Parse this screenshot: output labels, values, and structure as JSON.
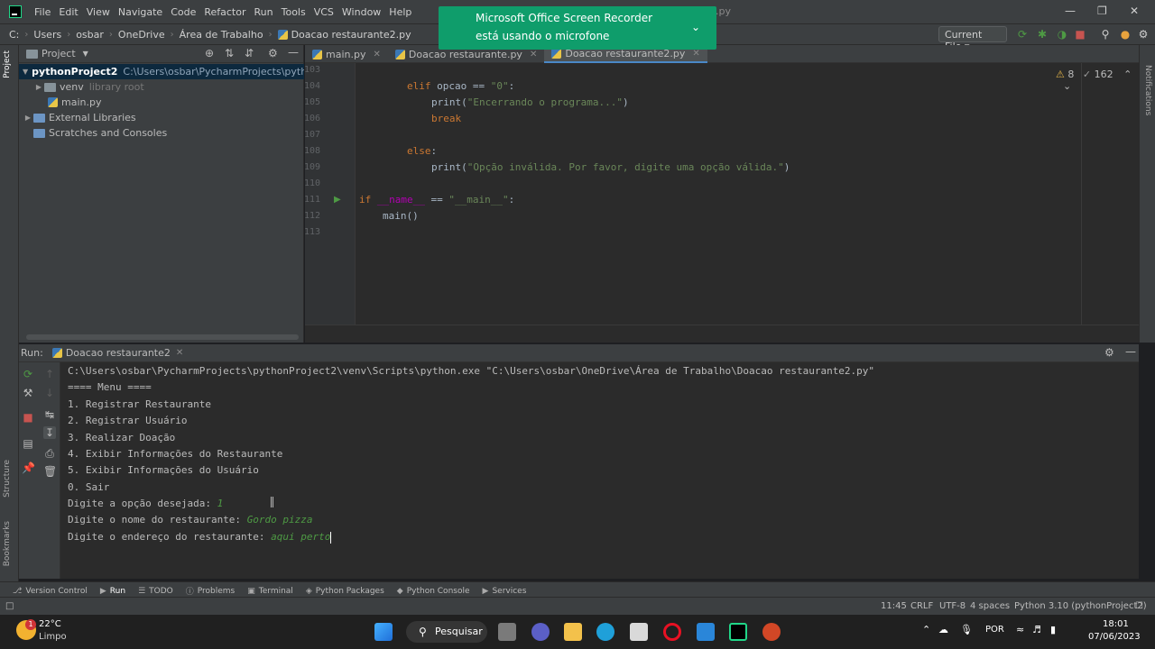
{
  "menu": [
    "File",
    "Edit",
    "View",
    "Navigate",
    "Code",
    "Refactor",
    "Run",
    "Tools",
    "VCS",
    "Window",
    "Help"
  ],
  "window_title_left": "pythonProj",
  "window_title_right": "2.py",
  "breadcrumb": [
    "C:",
    "Users",
    "osbar",
    "OneDrive",
    "Área de Trabalho",
    "Doacao restaurante2.py"
  ],
  "run_config": "Current File",
  "project": {
    "header": "Project",
    "tree": [
      {
        "label": "pythonProject2",
        "hint": "C:\\Users\\osbar\\PycharmProjects\\pythonProject2"
      },
      {
        "label": "venv",
        "hint": "library root"
      },
      {
        "label": "main.py",
        "hint": ""
      },
      {
        "label": "External Libraries",
        "hint": ""
      },
      {
        "label": "Scratches and Consoles",
        "hint": ""
      }
    ]
  },
  "editor_tabs": [
    "main.py",
    "Doacao restaurante.py",
    "Doacao restaurante2.py"
  ],
  "inspection": {
    "warnings": "8",
    "weak": "162"
  },
  "code": {
    "line_numbers": [
      "103",
      "104",
      "105",
      "106",
      "107",
      "108",
      "109",
      "110",
      "111",
      "112",
      "113"
    ],
    "l104_kw": "elif",
    "l104_rest": " opcao == ",
    "l104_str": "\"0\"",
    "l104_end": ":",
    "l105_fn": "print(",
    "l105_str": "\"Encerrando o programa...\"",
    "l105_end": ")",
    "l106_kw": "break",
    "l108_kw": "else",
    "l108_end": ":",
    "l109_fn": "print(",
    "l109_str": "\"Opção inválida. Por favor, digite uma opção válida.\"",
    "l109_end": ")",
    "l111_kw": "if",
    "l111_d1": "__name__",
    "l111_mid": " == ",
    "l111_str": "\"__main__\"",
    "l111_end": ":",
    "l112": "main()"
  },
  "run": {
    "label": "Run:",
    "tab": "Doacao restaurante2",
    "console": [
      {
        "text": "C:\\Users\\osbar\\PycharmProjects\\pythonProject2\\venv\\Scripts\\python.exe \"C:\\Users\\osbar\\OneDrive\\Área de Trabalho\\Doacao restaurante2.py\"",
        "input": ""
      },
      {
        "text": "==== Menu ====",
        "input": ""
      },
      {
        "text": "1. Registrar Restaurante",
        "input": ""
      },
      {
        "text": "2. Registrar Usuário",
        "input": ""
      },
      {
        "text": "3. Realizar Doação",
        "input": ""
      },
      {
        "text": "4. Exibir Informações do Restaurante",
        "input": ""
      },
      {
        "text": "5. Exibir Informações do Usuário",
        "input": ""
      },
      {
        "text": "0. Sair",
        "input": ""
      },
      {
        "text": "Digite a opção desejada: ",
        "input": "1"
      },
      {
        "text": "Digite o nome do restaurante: ",
        "input": "Gordo pizza"
      },
      {
        "text": "Digite o endereço do restaurante: ",
        "input": "aqui perto"
      }
    ]
  },
  "tool_windows": [
    "Version Control",
    "Run",
    "TODO",
    "Problems",
    "Terminal",
    "Python Packages",
    "Python Console",
    "Services"
  ],
  "status": {
    "position": "11:45",
    "line_sep": "CRLF",
    "encoding": "UTF-8",
    "indent": "4 spaces",
    "interpreter": "Python 3.10 (pythonProject2)"
  },
  "side_tabs": {
    "project": "Project",
    "structure": "Structure",
    "bookmarks": "Bookmarks",
    "notifications": "Notifications"
  },
  "toast": {
    "line1": "Microsoft Office Screen Recorder",
    "line2": "está usando o microfone"
  },
  "taskbar": {
    "weather_temp": "22°C",
    "weather_desc": "Limpo",
    "search": "Pesquisar",
    "lang": "POR",
    "time": "18:01",
    "date": "07/06/2023",
    "badge": "1"
  }
}
